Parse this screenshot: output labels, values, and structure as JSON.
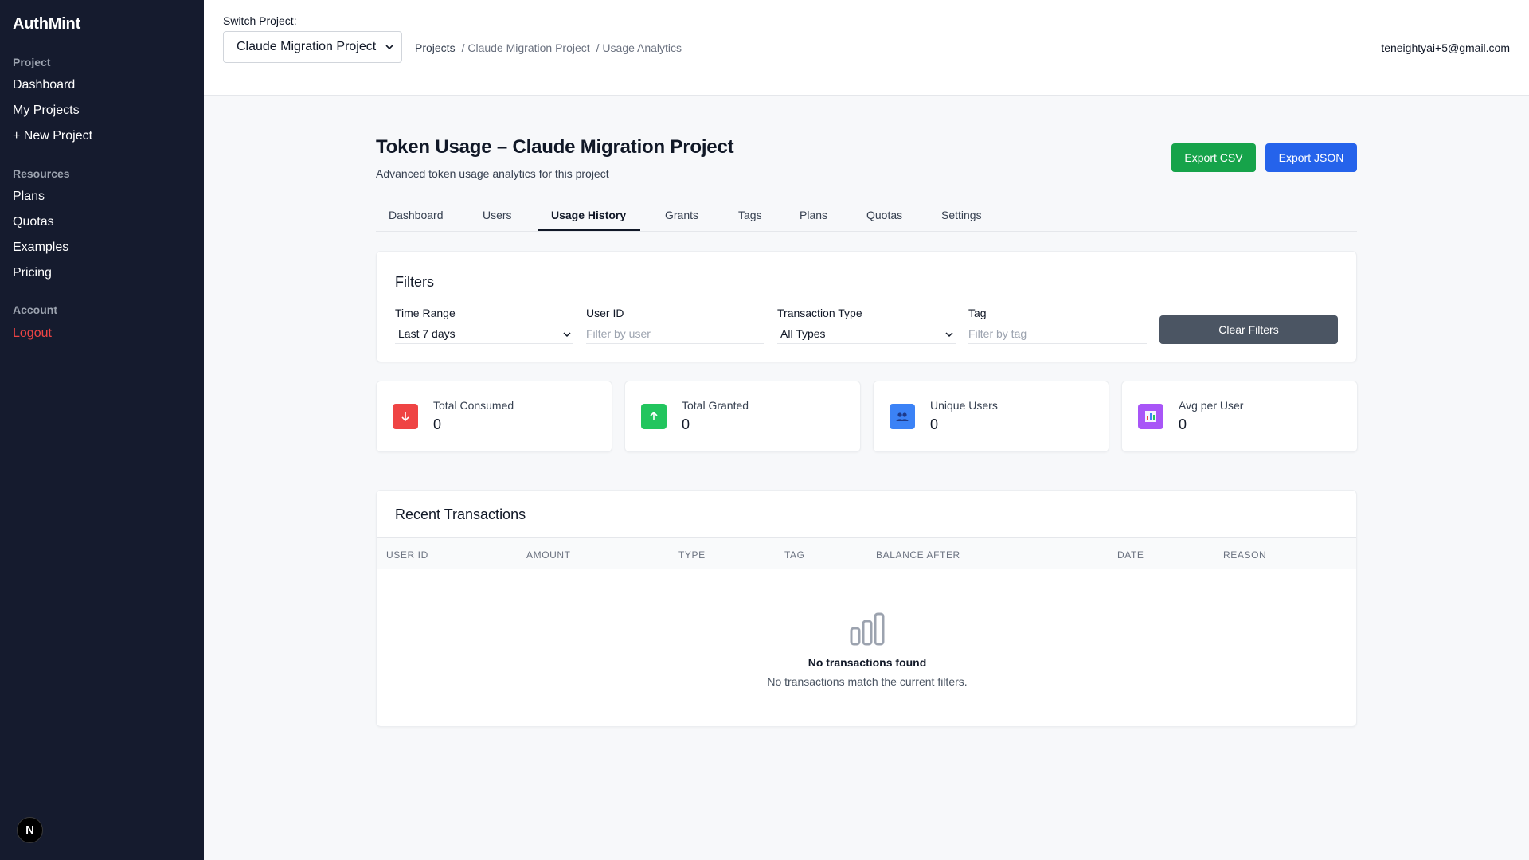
{
  "sidebar": {
    "brand": "AuthMint",
    "sections": {
      "project": "Project",
      "resources": "Resources",
      "account": "Account"
    },
    "items": {
      "dashboard": "Dashboard",
      "my_projects": "My Projects",
      "new_project": "+ New Project",
      "plans": "Plans",
      "quotas": "Quotas",
      "examples": "Examples",
      "pricing": "Pricing",
      "logout": "Logout"
    },
    "badge": "N"
  },
  "topbar": {
    "switch_label": "Switch Project:",
    "selected_project": "Claude Migration Project",
    "breadcrumb": [
      "Projects",
      "/ Claude Migration Project",
      "/ Usage Analytics"
    ],
    "user_email": "teneightyai+5@gmail.com"
  },
  "header": {
    "title": "Token Usage – Claude Migration Project",
    "subtitle": "Advanced token usage analytics for this project",
    "export_csv": "Export CSV",
    "export_json": "Export JSON"
  },
  "tabs": [
    "Dashboard",
    "Users",
    "Usage History",
    "Grants",
    "Tags",
    "Plans",
    "Quotas",
    "Settings"
  ],
  "active_tab": "Usage History",
  "filters": {
    "title": "Filters",
    "time_range_label": "Time Range",
    "time_range_value": "Last 7 days",
    "user_id_label": "User ID",
    "user_id_placeholder": "Filter by user",
    "type_label": "Transaction Type",
    "type_value": "All Types",
    "tag_label": "Tag",
    "tag_placeholder": "Filter by tag",
    "clear": "Clear Filters"
  },
  "stats": [
    {
      "label": "Total Consumed",
      "value": "0",
      "icon": "arrow-down-icon",
      "color": "#ef4444"
    },
    {
      "label": "Total Granted",
      "value": "0",
      "icon": "arrow-up-icon",
      "color": "#22c55e"
    },
    {
      "label": "Unique Users",
      "value": "0",
      "icon": "users-icon",
      "color": "#3b82f6"
    },
    {
      "label": "Avg per User",
      "value": "0",
      "icon": "bar-chart-icon",
      "color": "#a855f7"
    }
  ],
  "transactions": {
    "title": "Recent Transactions",
    "columns": [
      "User ID",
      "Amount",
      "Type",
      "Tag",
      "Balance After",
      "Date",
      "Reason"
    ],
    "empty_title": "No transactions found",
    "empty_subtitle": "No transactions match the current filters."
  }
}
